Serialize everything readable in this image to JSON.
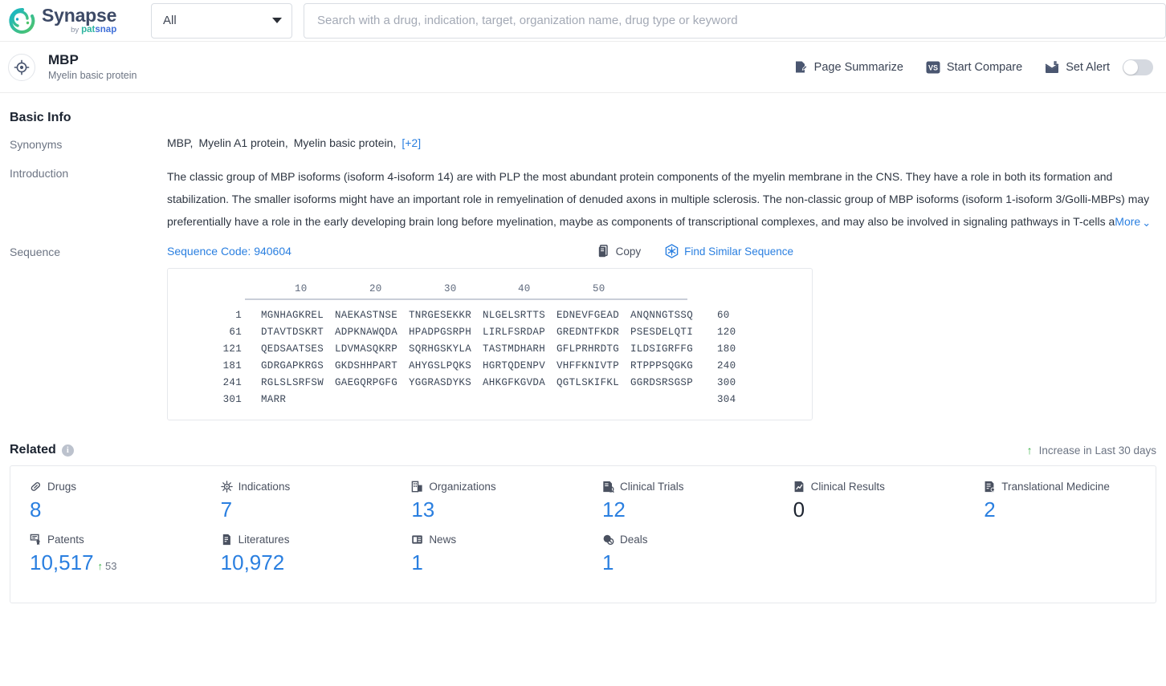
{
  "topbar": {
    "logo": {
      "title": "Synapse",
      "by": "by",
      "brand_a": "pat",
      "brand_b": "snap"
    },
    "scope_select": {
      "value": "All"
    },
    "search": {
      "value": "",
      "placeholder": "Search with a drug, indication, target, organization name, drug type or keyword"
    }
  },
  "entity": {
    "title": "MBP",
    "subtitle": "Myelin basic protein",
    "actions": {
      "page_summarize": "Page Summarize",
      "start_compare": "Start Compare",
      "compare_badge": "VS",
      "set_alert": "Set Alert",
      "alert_enabled": false
    }
  },
  "basic_info": {
    "title": "Basic Info",
    "synonyms_label": "Synonyms",
    "synonyms": [
      "MBP,",
      "Myelin A1 protein,",
      "Myelin basic protein,"
    ],
    "synonyms_more": "[+2]",
    "introduction_label": "Introduction",
    "introduction": "The classic group of MBP isoforms (isoform 4-isoform 14) are with PLP the most abundant protein components of the myelin membrane in the CNS. They have a role in both its formation and stabilization. The smaller isoforms might have an important role in remyelination of denuded axons in multiple sclerosis. The non-classic group of MBP isoforms (isoform 1-isoform 3/Golli-MBPs) may preferentially have a role in the early developing brain long before myelination, maybe as components of transcriptional complexes, and may also be involved in signaling pathways in T-cells a",
    "introduction_more": "More"
  },
  "sequence": {
    "label": "Sequence",
    "code_text": "Sequence Code: 940604",
    "copy_label": "Copy",
    "find_similar_label": "Find Similar Sequence",
    "ruler_ticks": [
      "10",
      "20",
      "30",
      "40",
      "50"
    ],
    "lines": [
      {
        "start": "1",
        "chunks": [
          "MGNHAGKREL",
          "NAEKASTNSE",
          "TNRGESEKKR",
          "NLGELSRTTS",
          "EDNEVFGEAD",
          "ANQNNGTSSQ"
        ],
        "end": "60"
      },
      {
        "start": "61",
        "chunks": [
          "DTAVTDSKRT",
          "ADPKNAWQDA",
          "HPADPGSRPH",
          "LIRLFSRDAP",
          "GREDNTFKDR",
          "PSESDELQTI"
        ],
        "end": "120"
      },
      {
        "start": "121",
        "chunks": [
          "QEDSAATSES",
          "LDVMASQKRP",
          "SQRHGSKYLA",
          "TASTMDHARH",
          "GFLPRHRDTG",
          "ILDSIGRFFG"
        ],
        "end": "180"
      },
      {
        "start": "181",
        "chunks": [
          "GDRGAPKRGS",
          "GKDSHHPART",
          "AHYGSLPQKS",
          "HGRTQDENPV",
          "VHFFKNIVTP",
          "RTPPPSQGKG"
        ],
        "end": "240"
      },
      {
        "start": "241",
        "chunks": [
          "RGLSLSRFSW",
          "GAEGQRPGFG",
          "YGGRASDYKS",
          "AHKGFKGVDA",
          "QGTLSKIFKL",
          "GGRDSRSGSP"
        ],
        "end": "300"
      },
      {
        "start": "301",
        "chunks": [
          "MARR",
          "",
          "",
          "",
          "",
          ""
        ],
        "end": "304"
      }
    ]
  },
  "related": {
    "title": "Related",
    "legend": "Increase in Last 30 days",
    "items": [
      {
        "icon": "drugs-icon",
        "label": "Drugs",
        "value": "8",
        "delta": null,
        "zero": false
      },
      {
        "icon": "indications-icon",
        "label": "Indications",
        "value": "7",
        "delta": null,
        "zero": false
      },
      {
        "icon": "organizations-icon",
        "label": "Organizations",
        "value": "13",
        "delta": null,
        "zero": false
      },
      {
        "icon": "clinical-trials-icon",
        "label": "Clinical Trials",
        "value": "12",
        "delta": null,
        "zero": false
      },
      {
        "icon": "clinical-results-icon",
        "label": "Clinical Results",
        "value": "0",
        "delta": null,
        "zero": true
      },
      {
        "icon": "translational-medicine-icon",
        "label": "Translational Medicine",
        "value": "2",
        "delta": null,
        "zero": false
      },
      {
        "icon": "patents-icon",
        "label": "Patents",
        "value": "10,517",
        "delta": "53",
        "zero": false
      },
      {
        "icon": "literatures-icon",
        "label": "Literatures",
        "value": "10,972",
        "delta": null,
        "zero": false
      },
      {
        "icon": "news-icon",
        "label": "News",
        "value": "1",
        "delta": null,
        "zero": false
      },
      {
        "icon": "deals-icon",
        "label": "Deals",
        "value": "1",
        "delta": null,
        "zero": false
      }
    ]
  },
  "colors": {
    "accent_blue": "#2a7fe0",
    "brand_teal": "#2fb5a0",
    "brand_blue": "#3f6fd8",
    "increase_green": "#3cb44a",
    "text_dark": "#1d2430",
    "text_muted": "#6c7483"
  }
}
